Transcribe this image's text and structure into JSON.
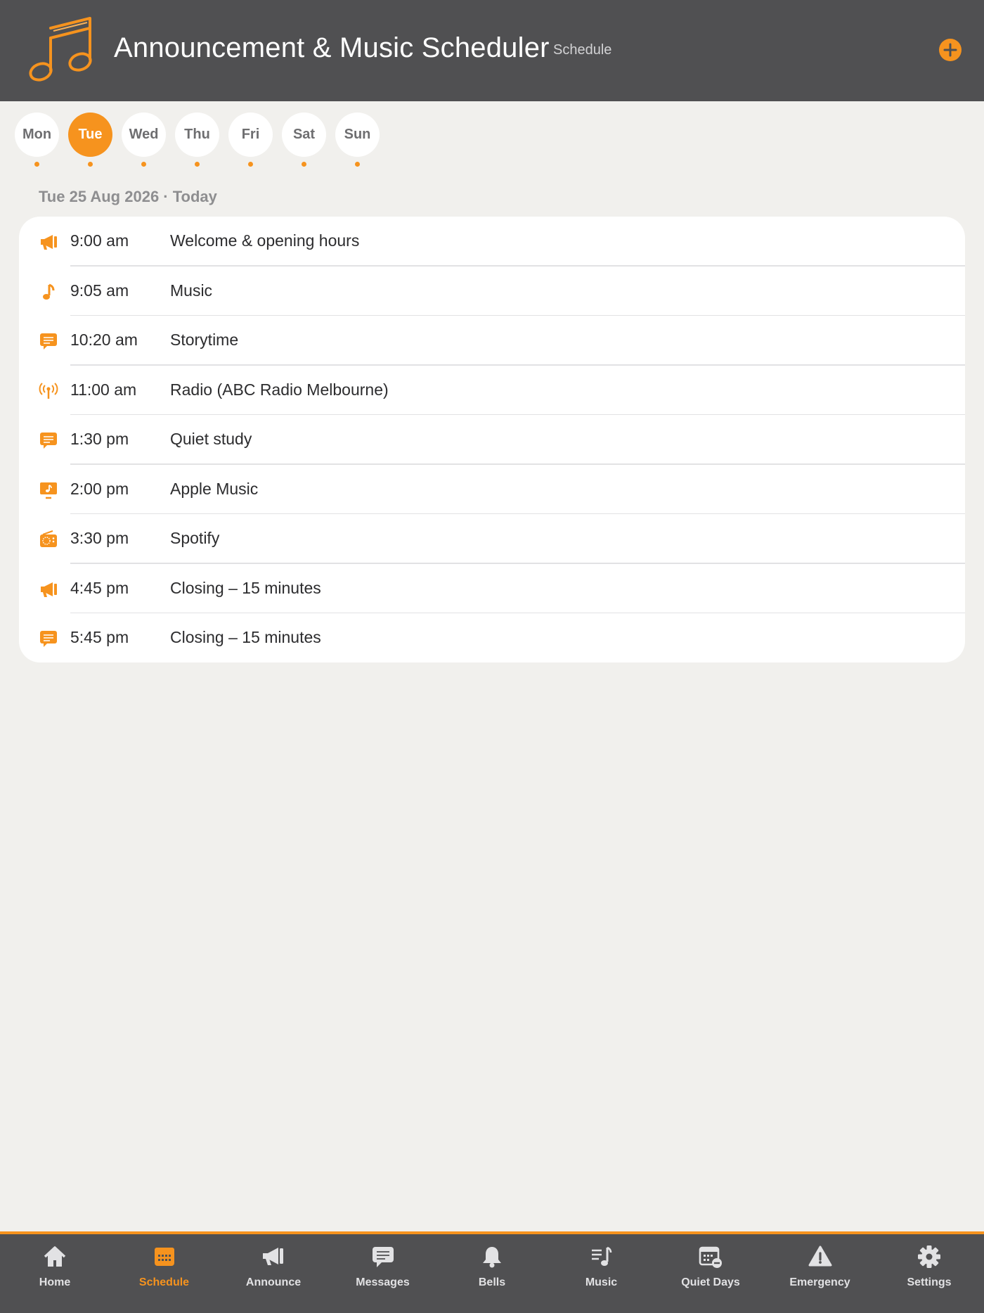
{
  "header": {
    "title": "Announcement & Music Scheduler",
    "screen_label": "Schedule",
    "add_icon": "plus-circle-icon",
    "logo_icon": "music-notes-icon"
  },
  "colors": {
    "accent": "#f6931e",
    "header_bg": "#505052",
    "page_bg": "#f1f0ed",
    "card_bg": "#ffffff"
  },
  "days": [
    {
      "label": "Mon",
      "selected": false,
      "has_events": true
    },
    {
      "label": "Tue",
      "selected": true,
      "has_events": true
    },
    {
      "label": "Wed",
      "selected": false,
      "has_events": true
    },
    {
      "label": "Thu",
      "selected": false,
      "has_events": true
    },
    {
      "label": "Fri",
      "selected": false,
      "has_events": true
    },
    {
      "label": "Sat",
      "selected": false,
      "has_events": true
    },
    {
      "label": "Sun",
      "selected": false,
      "has_events": true
    }
  ],
  "date_heading": "Tue 25 Aug 2026 · Today",
  "schedule": [
    {
      "icon": "megaphone-icon",
      "time": "9:00 am",
      "title": "Welcome & opening hours"
    },
    {
      "icon": "music-note-icon",
      "time": "9:05 am",
      "title": "Music"
    },
    {
      "icon": "message-bubble-icon",
      "time": "10:20 am",
      "title": "Storytime"
    },
    {
      "icon": "radio-antenna-icon",
      "time": "11:00 am",
      "title": "Radio (ABC Radio Melbourne)"
    },
    {
      "icon": "message-bubble-icon",
      "time": "1:30 pm",
      "title": "Quiet study"
    },
    {
      "icon": "music-screen-icon",
      "time": "2:00 pm",
      "title": "Apple Music"
    },
    {
      "icon": "radio-icon",
      "time": "3:30 pm",
      "title": "Spotify"
    },
    {
      "icon": "megaphone-icon",
      "time": "4:45 pm",
      "title": "Closing – 15 minutes"
    },
    {
      "icon": "message-bubble-icon",
      "time": "5:45 pm",
      "title": "Closing – 15 minutes"
    }
  ],
  "tabs": [
    {
      "label": "Home",
      "icon": "home-icon",
      "active": false
    },
    {
      "label": "Schedule",
      "icon": "calendar-icon",
      "active": true
    },
    {
      "label": "Announce",
      "icon": "megaphone-icon",
      "active": false
    },
    {
      "label": "Messages",
      "icon": "message-bubble-icon",
      "active": false
    },
    {
      "label": "Bells",
      "icon": "bell-icon",
      "active": false
    },
    {
      "label": "Music",
      "icon": "music-list-icon",
      "active": false
    },
    {
      "label": "Quiet Days",
      "icon": "calendar-minus-icon",
      "active": false
    },
    {
      "label": "Emergency",
      "icon": "warning-icon",
      "active": false
    },
    {
      "label": "Settings",
      "icon": "gear-icon",
      "active": false
    }
  ]
}
